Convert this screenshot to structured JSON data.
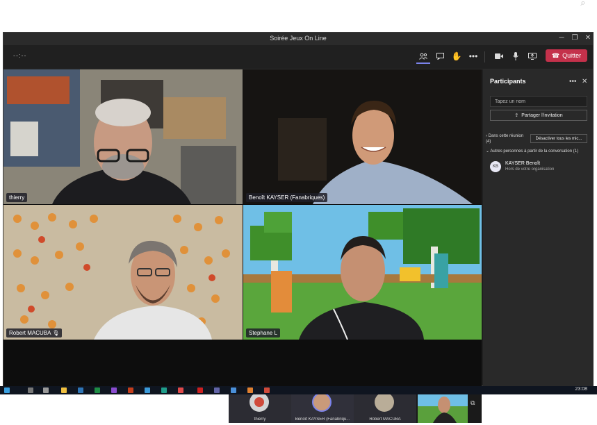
{
  "window": {
    "title": "Soirée Jeux On Line"
  },
  "toolbar": {
    "timer": "--:--",
    "leave_label": "Quitter",
    "icons": [
      "participants-icon",
      "chat-icon",
      "raise-hand-icon",
      "more-icon",
      "camera-icon",
      "microphone-icon",
      "share-screen-icon"
    ]
  },
  "participants": [
    {
      "name": "thierry"
    },
    {
      "name": "Benoît KAYSER (Fanabriques)"
    },
    {
      "name": "Robert MACUBA"
    },
    {
      "name": "Stephane L"
    }
  ],
  "pane": {
    "title": "Participants",
    "search_placeholder": "Tapez un nom",
    "share_label": "Partager l'invitation",
    "in_meeting_label": "Dans cette réunion (4)",
    "mute_all_label": "Désactiver tous les mic...",
    "others_label": "Autres personnes à partir de la conversation (1)",
    "people": [
      {
        "initials": "KB",
        "name": "KAYSER Benoît",
        "status": "Hors de votre organisation"
      }
    ]
  },
  "strip": {
    "items": [
      {
        "name": "thierry"
      },
      {
        "name": "Benoît KAYSER (Fanabriqu..."
      },
      {
        "name": "Robert MACUBA"
      }
    ]
  },
  "taskbar": {
    "clock": "23:08"
  },
  "colors": {
    "accent": "#7b83eb",
    "leave": "#c4314b"
  }
}
